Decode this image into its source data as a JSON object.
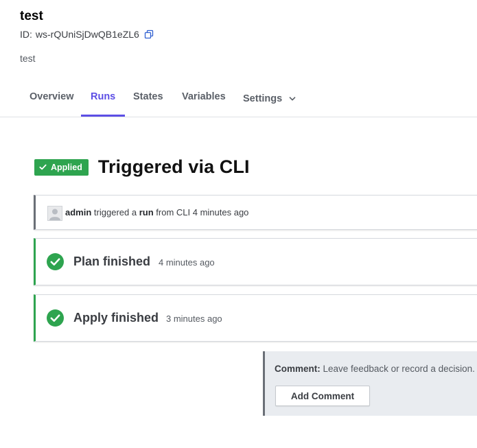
{
  "workspace": {
    "name": "test",
    "id_label": "ID:",
    "id_value": "ws-rQUniSjDwQB1eZL6",
    "description": "test"
  },
  "tabs": [
    {
      "label": "Overview",
      "active": false
    },
    {
      "label": "Runs",
      "active": true
    },
    {
      "label": "States",
      "active": false
    },
    {
      "label": "Variables",
      "active": false
    },
    {
      "label": "Settings",
      "active": false
    }
  ],
  "run": {
    "status_badge": "Applied",
    "title": "Triggered via CLI",
    "trigger": {
      "user": "admin",
      "text_1": "triggered a",
      "run_word": "run",
      "text_2": "from CLI 4 minutes ago"
    },
    "plan": {
      "title": "Plan finished",
      "time": "4 minutes ago"
    },
    "apply": {
      "title": "Apply finished",
      "time": "3 minutes ago"
    }
  },
  "comment": {
    "label": "Comment:",
    "prompt": "Leave feedback or record a decision.",
    "button": "Add Comment"
  },
  "colors": {
    "accent": "#5c4ee5",
    "success": "#2ea44f",
    "neutral_border": "#6a6f77"
  }
}
